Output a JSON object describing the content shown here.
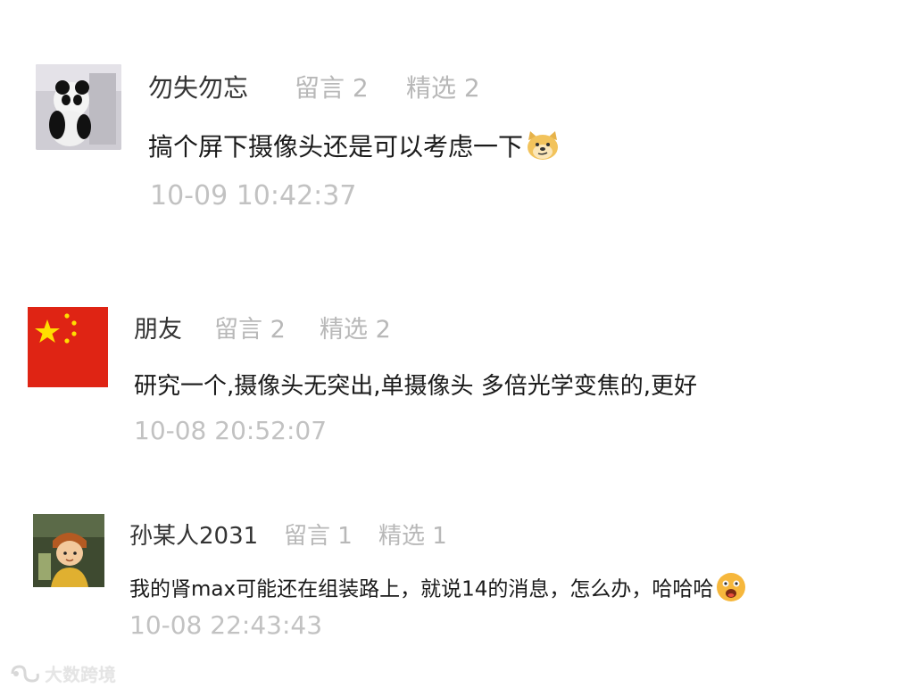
{
  "comments": [
    {
      "author": "勿失勿忘",
      "messages_label": "留言 2",
      "selected_label": "精选 2",
      "text": "搞个屏下摄像头还是可以考虑一下",
      "emoji": "doge-emoji",
      "time": "10-09 10:42:37"
    },
    {
      "author": "朋友",
      "messages_label": "留言 2",
      "selected_label": "精选 2",
      "text": "研究一个,摄像头无突出,单摄像头 多倍光学变焦的,更好",
      "time": "10-08 20:52:07"
    },
    {
      "author": "孙某人2031",
      "messages_label": "留言 1",
      "selected_label": "精选 1",
      "text": "我的肾max可能还在组装路上，就说14的消息，怎么办，哈哈哈",
      "emoji": "shocked-face-emoji",
      "time": "10-08 22:43:43"
    }
  ],
  "watermark": "大数跨境",
  "colors": {
    "meta_gray": "#b8b8b8",
    "flag_red": "#df2414",
    "flag_yellow": "#ffde00"
  }
}
